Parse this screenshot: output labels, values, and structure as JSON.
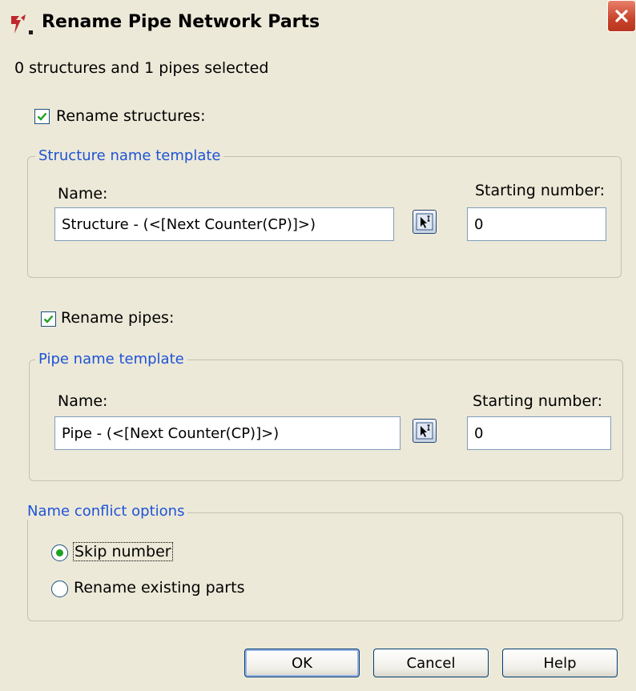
{
  "window": {
    "title": "Rename Pipe Network Parts",
    "icon": "civil3d-app-icon",
    "close_icon": "close-icon"
  },
  "selection_summary": "0 structures and 1 pipes selected",
  "rename_structures": {
    "label": "Rename structures:",
    "checked": true
  },
  "structure_template": {
    "legend": "Structure name template",
    "name_label": "Name:",
    "name_value": "Structure - (<[Next Counter(CP)]>)",
    "start_label": "Starting number:",
    "start_value": "0",
    "picker_icon": "name-template-picker-icon"
  },
  "rename_pipes": {
    "label": "Rename pipes:",
    "checked": true
  },
  "pipe_template": {
    "legend": "Pipe name template",
    "name_label": "Name:",
    "name_value": "Pipe - (<[Next Counter(CP)]>)",
    "start_label": "Starting number:",
    "start_value": "0",
    "picker_icon": "name-template-picker-icon"
  },
  "conflict": {
    "legend": "Name conflict options",
    "options": [
      {
        "label": "Skip number",
        "selected": true
      },
      {
        "label": "Rename existing parts",
        "selected": false
      }
    ]
  },
  "buttons": {
    "ok": "OK",
    "cancel": "Cancel",
    "help": "Help"
  },
  "colors": {
    "dialog_bg": "#ece9d8",
    "legend_text": "#1f53d6",
    "check_mark": "#21a121",
    "close_button": "#c8432b"
  }
}
